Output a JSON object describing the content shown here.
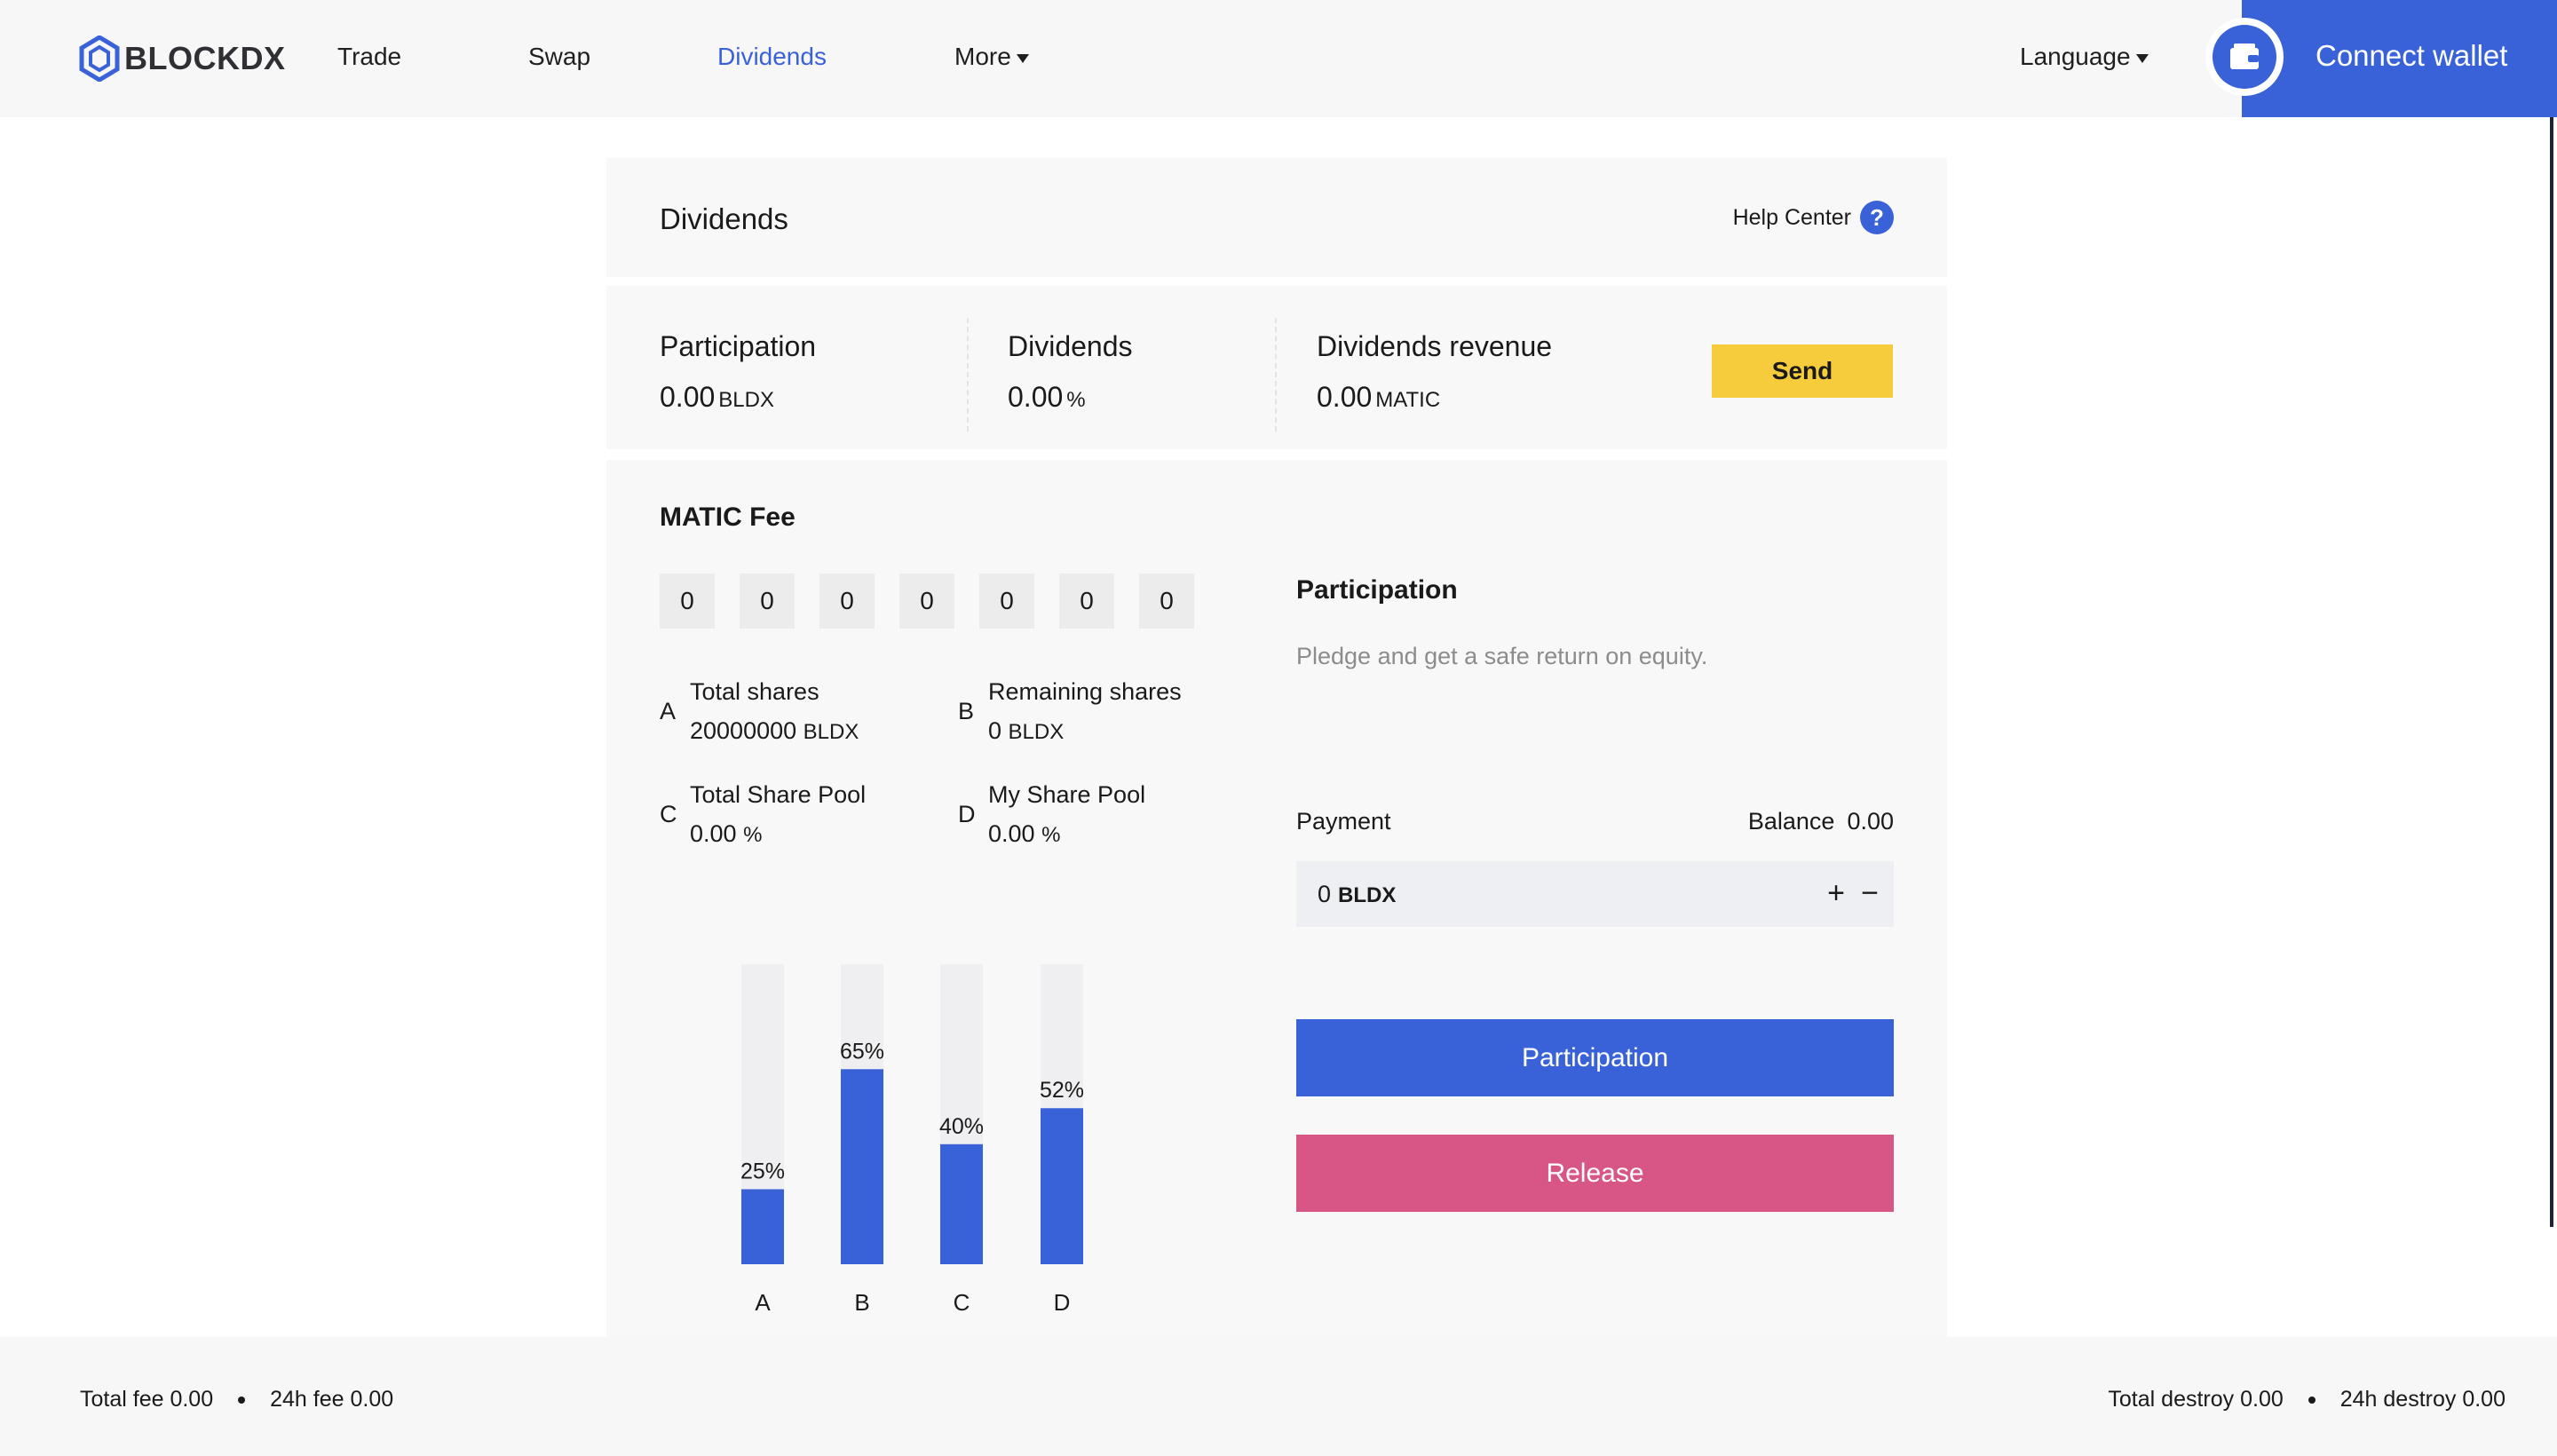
{
  "brand": {
    "name": "BLOCKDX",
    "logo_icon": "hexagon-logo-icon"
  },
  "nav": {
    "trade": "Trade",
    "swap": "Swap",
    "dividends": "Dividends",
    "more": "More",
    "active": "Dividends"
  },
  "header": {
    "language": "Language",
    "connect_wallet": "Connect wallet",
    "wallet_icon": "wallet-icon"
  },
  "title_panel": {
    "title": "Dividends",
    "help": "Help Center",
    "help_icon": "?"
  },
  "stats": {
    "participation": {
      "label": "Participation",
      "value": "0.00",
      "unit": "BLDX"
    },
    "dividends": {
      "label": "Dividends",
      "value": "0.00",
      "unit": "%"
    },
    "revenue": {
      "label": "Dividends revenue",
      "value": "0.00",
      "unit": "MATIC"
    },
    "send": "Send"
  },
  "fee": {
    "title": "MATIC Fee",
    "digits": [
      "0",
      "0",
      "0",
      "0",
      "0",
      "0",
      "0"
    ]
  },
  "shares": {
    "a": {
      "letter": "A",
      "label": "Total shares",
      "value": "20000000",
      "unit": "BLDX"
    },
    "b": {
      "letter": "B",
      "label": "Remaining shares",
      "value": "0",
      "unit": "BLDX"
    },
    "c": {
      "letter": "C",
      "label": "Total Share Pool",
      "value": "0.00",
      "unit": "%"
    },
    "d": {
      "letter": "D",
      "label": "My Share Pool",
      "value": "0.00",
      "unit": "%"
    }
  },
  "chart_data": {
    "type": "bar",
    "categories": [
      "A",
      "B",
      "C",
      "D"
    ],
    "values": [
      25,
      65,
      40,
      52
    ],
    "data_labels": [
      "25%",
      "65%",
      "40%",
      "52%"
    ],
    "ylim": [
      0,
      100
    ],
    "title": "",
    "xlabel": "",
    "ylabel": "",
    "bar_color": "#3a62d8",
    "track_color": "#efeff1"
  },
  "participation_panel": {
    "title": "Participation",
    "description": "Pledge and get a safe return on equity.",
    "payment_label": "Payment",
    "balance_label": "Balance",
    "balance_value": "0.00",
    "amount": "0",
    "amount_unit": "BLDX",
    "plus": "+",
    "minus": "−",
    "participate_button": "Participation",
    "release_button": "Release"
  },
  "footer": {
    "total_fee": "Total fee 0.00",
    "fee_24h": "24h fee 0.00",
    "total_destroy": "Total destroy 0.00",
    "destroy_24h": "24h destroy 0.00"
  },
  "colors": {
    "accent": "#3a62d8",
    "send": "#f6cb3c",
    "release": "#d85686"
  }
}
